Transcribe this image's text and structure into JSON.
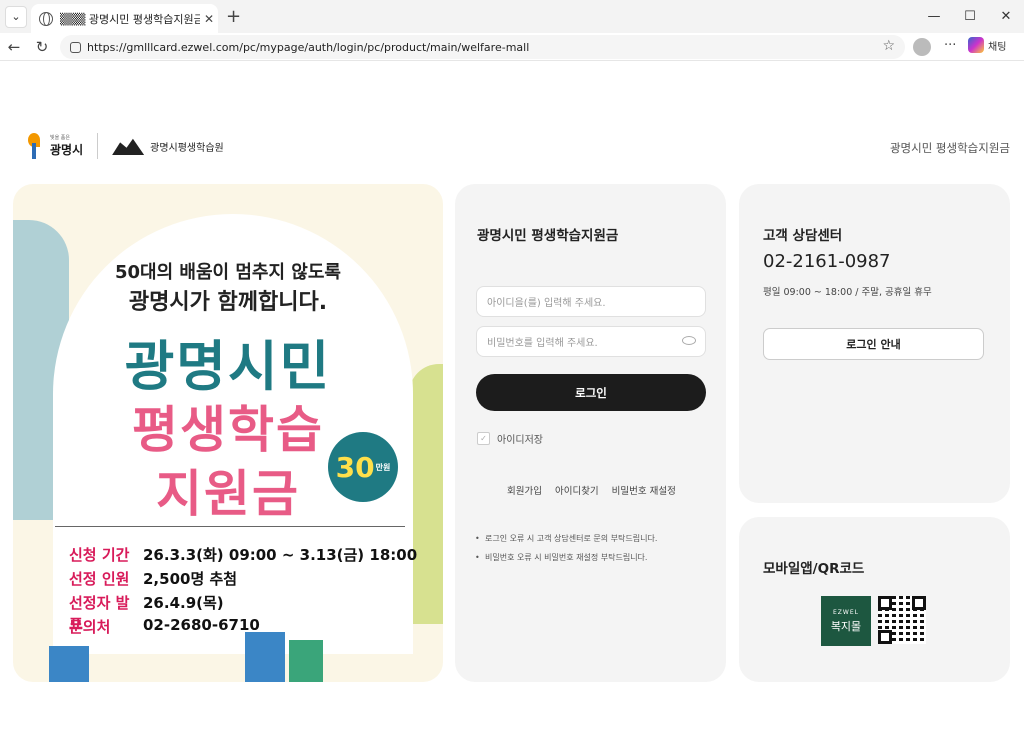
{
  "browser": {
    "tab_title": "▒▒▒ 광명시민 평생학습지원금 ▒▒",
    "url": "https://gmlllcard.ezwel.com/pc/mypage/auth/login/pc/product/main/welfare-mall",
    "copilot_label": "채팅"
  },
  "header": {
    "city_tagline": "빛을 품은",
    "city_name": "광명시",
    "institute_name": "광명시평생학습원",
    "right_text": "광명시민 평생학습지원금"
  },
  "banner": {
    "headline1": "50대의 배움이 멈추지 않도록",
    "headline2": "광명시가 함께합니다.",
    "big1": "광명시민",
    "big2": "평생학습",
    "big3": "지원금",
    "badge_amount": "30",
    "badge_unit": "만원",
    "info": [
      {
        "k": "신청 기간",
        "v": "26.3.3(화) 09:00 ~ 3.13(금) 18:00"
      },
      {
        "k": "선정 인원",
        "v": "2,500명 추첨"
      },
      {
        "k": "선정자 발표",
        "v": "26.4.9(목)"
      },
      {
        "k": "문의처",
        "v": "02-2680-6710"
      }
    ]
  },
  "login": {
    "title": "광명시민 평생학습지원금",
    "id_placeholder": "아이디을(를) 입력해 주세요.",
    "pw_placeholder": "비밀번호를 입력해 주세요.",
    "login_button": "로그인",
    "save_id": "아이디저장",
    "links": [
      "회원가입",
      "아이디찾기",
      "비밀번호 재설정"
    ],
    "notes": [
      "로그인 오류 시 고객 상담센터로 문의 부탁드립니다.",
      "비밀번호 오류 시 비밀번호 재설정 부탁드립니다."
    ]
  },
  "cs": {
    "title": "고객 상담센터",
    "phone": "02-2161-0987",
    "hours": "평일 09:00 ~ 18:00 / 주말, 공휴일 휴무",
    "guide_button": "로그인 안내"
  },
  "mobile": {
    "title": "모바일앱/QR코드",
    "app_brand": "EZWEL",
    "app_name": "복지몰"
  }
}
